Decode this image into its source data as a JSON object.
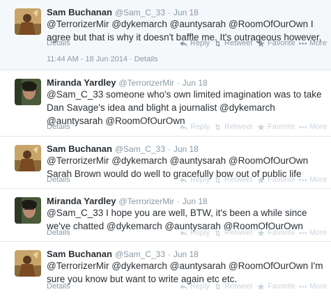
{
  "labels": {
    "details": "Details",
    "reply": "Reply",
    "retweet": "Retweet",
    "favorite": "Favorite",
    "more": "More"
  },
  "colors": {
    "link": "#292f33",
    "muted": "#8899a6",
    "divider": "#e1e8ed"
  },
  "tweets": [
    {
      "name": "Sam Buchanan",
      "handle": "@Sam_C_33",
      "time": "Jun 18",
      "text": "@TerrorizerMir @dykemarch @auntysarah @RoomOfOurOwn I agree but that is why it doesn't baffle me. It's outrageous however,",
      "timestamp": "11:44 AM - 18 Jun 2014 · Details"
    },
    {
      "name": "Miranda Yardley",
      "handle": "@TerrorizerMir",
      "time": "Jun 18",
      "text": "@Sam_C_33 someone who's own limited imagination was to take Dan Savage's idea and blight a journalist @dykemarch @auntysarah @RoomOfOurOwn"
    },
    {
      "name": "Sam Buchanan",
      "handle": "@Sam_C_33",
      "time": "Jun 18",
      "text": "@TerrorizerMir @dykemarch @auntysarah @RoomOfOurOwn Sarah Brown would do well to gracefully bow out of public life"
    },
    {
      "name": "Miranda Yardley",
      "handle": "@TerrorizerMir",
      "time": "Jun 18",
      "text": "@Sam_C_33 I hope you are well, BTW, it's been a while since we've chatted @dykemarch @auntysarah @RoomOfOurOwn"
    },
    {
      "name": "Sam Buchanan",
      "handle": "@Sam_C_33",
      "time": "Jun 18",
      "text": "@TerrorizerMir @dykemarch @auntysarah @RoomOfOurOwn I'm sure you know but want to write  again etc etc."
    }
  ]
}
